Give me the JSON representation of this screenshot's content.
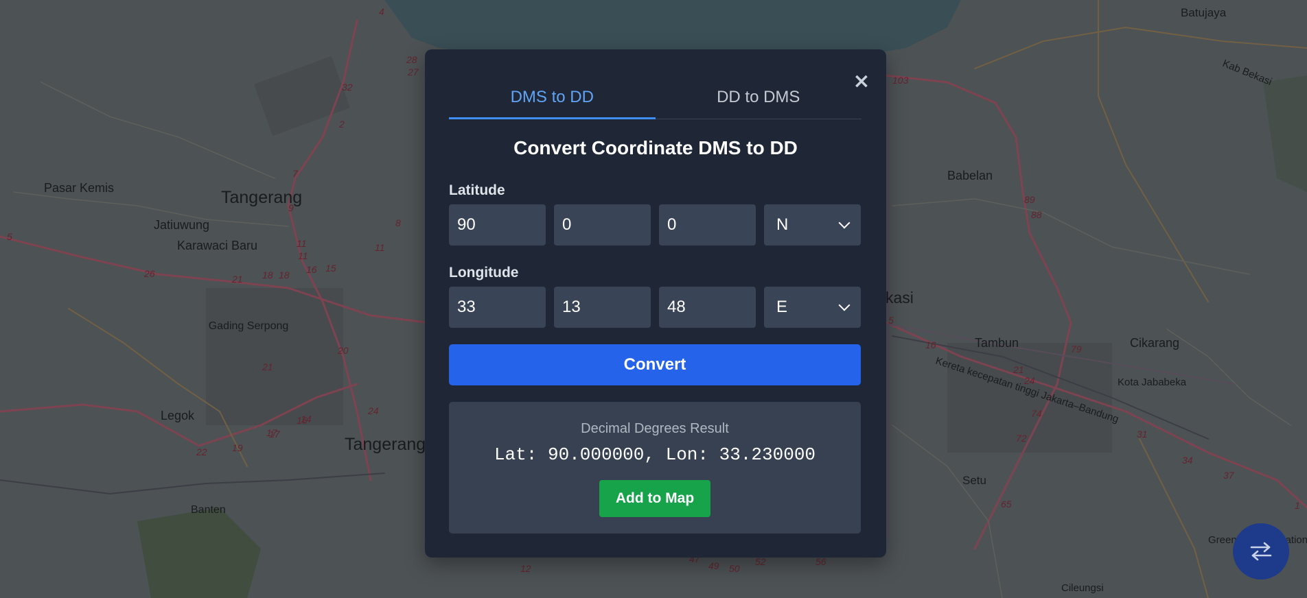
{
  "map": {
    "places": [
      "Batujaya",
      "Kab Bekasi",
      "Pasar Kemis",
      "Tangerang",
      "Jatiuwung",
      "Karawaci Baru",
      "Babelan",
      "Gading Serpong",
      "Legok",
      "Tangerang Selatan",
      "Banten",
      "Tambun",
      "Cikarang",
      "Kota Jababeka",
      "Kereta kecepatan tinggi Jakarta–Bandung",
      "Setu",
      "Cileungsi",
      "Greenland International Industrial Center",
      "kasi"
    ],
    "road_numbers": [
      "4",
      "28",
      "27",
      "32",
      "2",
      "7",
      "9",
      "8",
      "11",
      "11",
      "11",
      "15",
      "16",
      "18",
      "18",
      "21",
      "26",
      "20",
      "21",
      "24",
      "17",
      "16",
      "14",
      "22",
      "19",
      "17",
      "89",
      "88",
      "79",
      "16",
      "21",
      "24",
      "74",
      "72",
      "65",
      "31",
      "34",
      "37",
      "1",
      "12",
      "47",
      "49",
      "50",
      "52",
      "56",
      "103",
      "5",
      "5"
    ]
  },
  "modal": {
    "close_icon": "×",
    "tabs": [
      {
        "label": "DMS to DD",
        "active": true
      },
      {
        "label": "DD to DMS",
        "active": false
      }
    ],
    "title": "Convert Coordinate DMS to DD",
    "latitude": {
      "label": "Latitude",
      "degrees": "90",
      "minutes": "0",
      "seconds": "0",
      "direction": "N"
    },
    "longitude": {
      "label": "Longitude",
      "degrees": "33",
      "minutes": "13",
      "seconds": "48",
      "direction": "E"
    },
    "convert_label": "Convert",
    "result": {
      "caption": "Decimal Degrees Result",
      "value": "Lat: 90.000000, Lon: 33.230000",
      "add_label": "Add to Map"
    }
  },
  "fab": {
    "icon": "swap-arrows-icon"
  },
  "colors": {
    "modal_bg": "#1f2737",
    "input_bg": "#3a4457",
    "accent": "#2563eb",
    "active_tab": "#62a4f4",
    "success": "#16a34a"
  }
}
